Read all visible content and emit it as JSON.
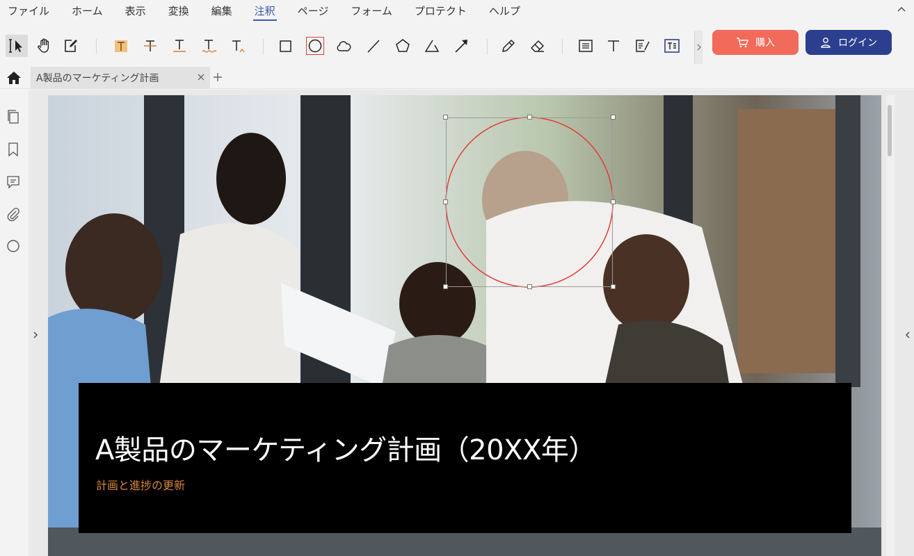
{
  "menu": {
    "items": [
      "ファイル",
      "ホーム",
      "表示",
      "変換",
      "編集",
      "注釈",
      "ページ",
      "フォーム",
      "プロテクト",
      "ヘルプ"
    ],
    "active": "注釈"
  },
  "toolbar": {
    "tools": [
      "select-icon",
      "hand-icon",
      "edit-note-icon",
      "highlight-icon",
      "strikethrough-icon",
      "underline-icon",
      "squiggly-underline-icon",
      "insert-text-icon",
      "rectangle-icon",
      "ellipse-icon",
      "cloud-icon",
      "line-icon",
      "polygon-icon",
      "polyline-icon",
      "arrow-icon",
      "pencil-icon",
      "eraser-icon",
      "text-box-icon",
      "typewriter-icon",
      "callout-icon",
      "text-field-icon"
    ],
    "active_tool": "ellipse-icon"
  },
  "buttons": {
    "buy_label": "購入",
    "login_label": "ログイン"
  },
  "tabs": {
    "document_title": "A製品のマーケティング計画"
  },
  "sidebar": {
    "icons": [
      "pages-icon",
      "bookmark-icon",
      "comment-icon",
      "attachment-icon",
      "search-icon"
    ]
  },
  "slide": {
    "title": "A製品のマーケティング計画（20XX年）",
    "subtitle": "計画と進捗の更新"
  },
  "colors": {
    "accent": "#3a5aa8",
    "buy": "#f26a5a",
    "login": "#2c3f8f",
    "annotation": "#e53935",
    "subtitle": "#d9873b"
  }
}
